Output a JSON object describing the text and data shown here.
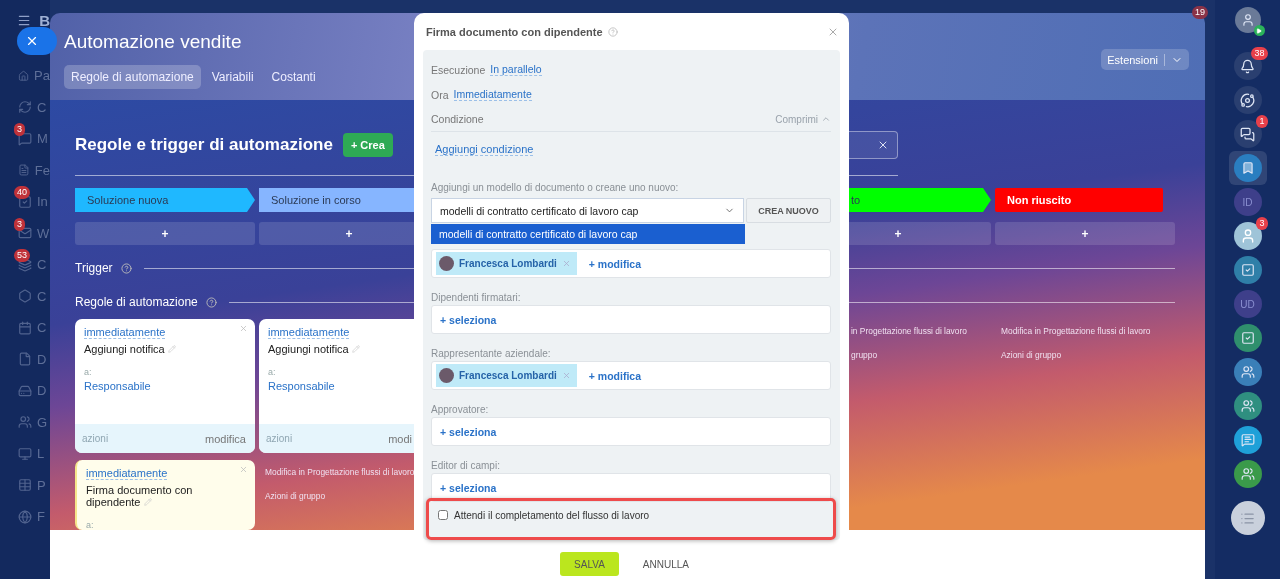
{
  "left_sidebar": {
    "title": "B",
    "items": [
      {
        "kind": "home",
        "label": "Pa"
      },
      {
        "kind": "cycle",
        "label": "C"
      },
      {
        "kind": "chat",
        "label": "M",
        "badge": "3"
      },
      {
        "kind": "feed",
        "label": "Fe"
      },
      {
        "kind": "tasks",
        "label": "In",
        "badge": "40"
      },
      {
        "kind": "mail",
        "label": "W",
        "badge": "3"
      },
      {
        "kind": "stack",
        "label": "C",
        "badge": "53"
      },
      {
        "kind": "hexagon",
        "label": "C"
      },
      {
        "kind": "calendar",
        "label": "C"
      },
      {
        "kind": "doc",
        "label": "D"
      },
      {
        "kind": "drive",
        "label": "D"
      },
      {
        "kind": "group",
        "label": "G"
      },
      {
        "kind": "screen",
        "label": "L"
      },
      {
        "kind": "table",
        "label": "P"
      },
      {
        "kind": "site",
        "label": "F"
      }
    ]
  },
  "panel": {
    "title": "Automazione vendite",
    "tabs": [
      {
        "label": "Regole di automazione",
        "selected": true
      },
      {
        "label": "Variabili",
        "selected": false
      },
      {
        "label": "Costanti",
        "selected": false
      }
    ],
    "extensions_button": "Estensioni",
    "heading": "Regole e trigger di automazione",
    "create_button": "+ Crea",
    "columns": [
      {
        "stage": "Soluzione nuova",
        "color": "#1fb8ff",
        "add": "+",
        "cards": [
          {
            "kind": "white",
            "timing": "immediatamente",
            "action": "Aggiungi notifica",
            "to_label": "a:",
            "recipient": "Responsabile",
            "footer_left": "azioni",
            "footer_right": "modifica"
          },
          {
            "kind": "yellow",
            "timing": "immediatamente",
            "action": "Firma documento con dipendente",
            "to_label": "a:"
          }
        ]
      },
      {
        "stage": "Soluzione in corso",
        "color": "#86b5ff",
        "add": "+",
        "cards": [
          {
            "kind": "white",
            "timing": "immediatamente",
            "action": "Aggiungi notifica",
            "to_label": "a:",
            "recipient": "Responsabile",
            "footer_left": "azioni",
            "footer_right": "modi"
          }
        ],
        "links": [
          "Modifica in Progettazione flussi di lavoro",
          "Azioni di gruppo"
        ]
      },
      {
        "stage": "to",
        "color": "#00ff00",
        "add": "+",
        "links": [
          "in Progettazione flussi di lavoro",
          "gruppo"
        ]
      },
      {
        "stage": "Non riuscito",
        "color": "#ff0000",
        "add": "+",
        "links": [
          "Modifica in Progettazione flussi di lavoro",
          "Azioni di gruppo"
        ]
      }
    ],
    "trigger_label": "Trigger",
    "rules_label": "Regole di automazione"
  },
  "dialog": {
    "title": "Firma documento con dipendente",
    "rows": [
      {
        "label": "Esecuzione",
        "value": "In parallelo"
      },
      {
        "label": "Ora",
        "value": "Immediatamente"
      }
    ],
    "condition": {
      "label": "Condizione",
      "toggle": "Comprimi",
      "expanded": true,
      "add_link": "Aggiungi condizione"
    },
    "template": {
      "label": "Aggiungi un modello di documento o creane uno nuovo:",
      "value": "modelli di contratto certificato di lavoro cap",
      "create_button": "CREA NUOVO",
      "open": true,
      "options": [
        {
          "label": "modelli di contratto certificato di lavoro cap",
          "selected": true
        }
      ]
    },
    "fields": [
      {
        "people": [
          "Francesca Lombardi"
        ],
        "action": "+ modifica"
      },
      {
        "label": "Dipendenti firmatari:",
        "action": "+ seleziona"
      },
      {
        "label": "Rappresentante aziendale:",
        "people": [
          "Francesca Lombardi"
        ],
        "action": "+ modifica"
      },
      {
        "label": "Approvatore:",
        "action": "+ seleziona"
      },
      {
        "label": "Editor di campi:",
        "action": "+ seleziona"
      }
    ],
    "wait_option": {
      "label": "Attendi il completamento del flusso di lavoro",
      "checked": false,
      "highlighted": true
    },
    "buttons": [
      {
        "label": "SALVA",
        "kind": "primary"
      },
      {
        "label": "ANNULLA",
        "kind": "link"
      }
    ]
  },
  "right_sidebar": {
    "profile_badge": "19",
    "items": [
      {
        "kind": "bell",
        "badge": "38"
      },
      {
        "kind": "spiral"
      },
      {
        "kind": "chat",
        "badge": "1"
      },
      {
        "kind": "bookmark",
        "selected": true
      },
      {
        "kind": "initials",
        "text": "ID"
      },
      {
        "kind": "avatar",
        "badge": "3"
      },
      {
        "kind": "task",
        "color": "#2f7fa8"
      },
      {
        "kind": "initials",
        "text": "UD"
      },
      {
        "kind": "task",
        "color": "#2f8f6d"
      },
      {
        "kind": "group",
        "color": "#3a7fb8"
      },
      {
        "kind": "group",
        "color": "#2f8f80"
      },
      {
        "kind": "messages",
        "color": "#1fa0d8"
      },
      {
        "kind": "group",
        "color": "#3a9a4a"
      }
    ]
  }
}
